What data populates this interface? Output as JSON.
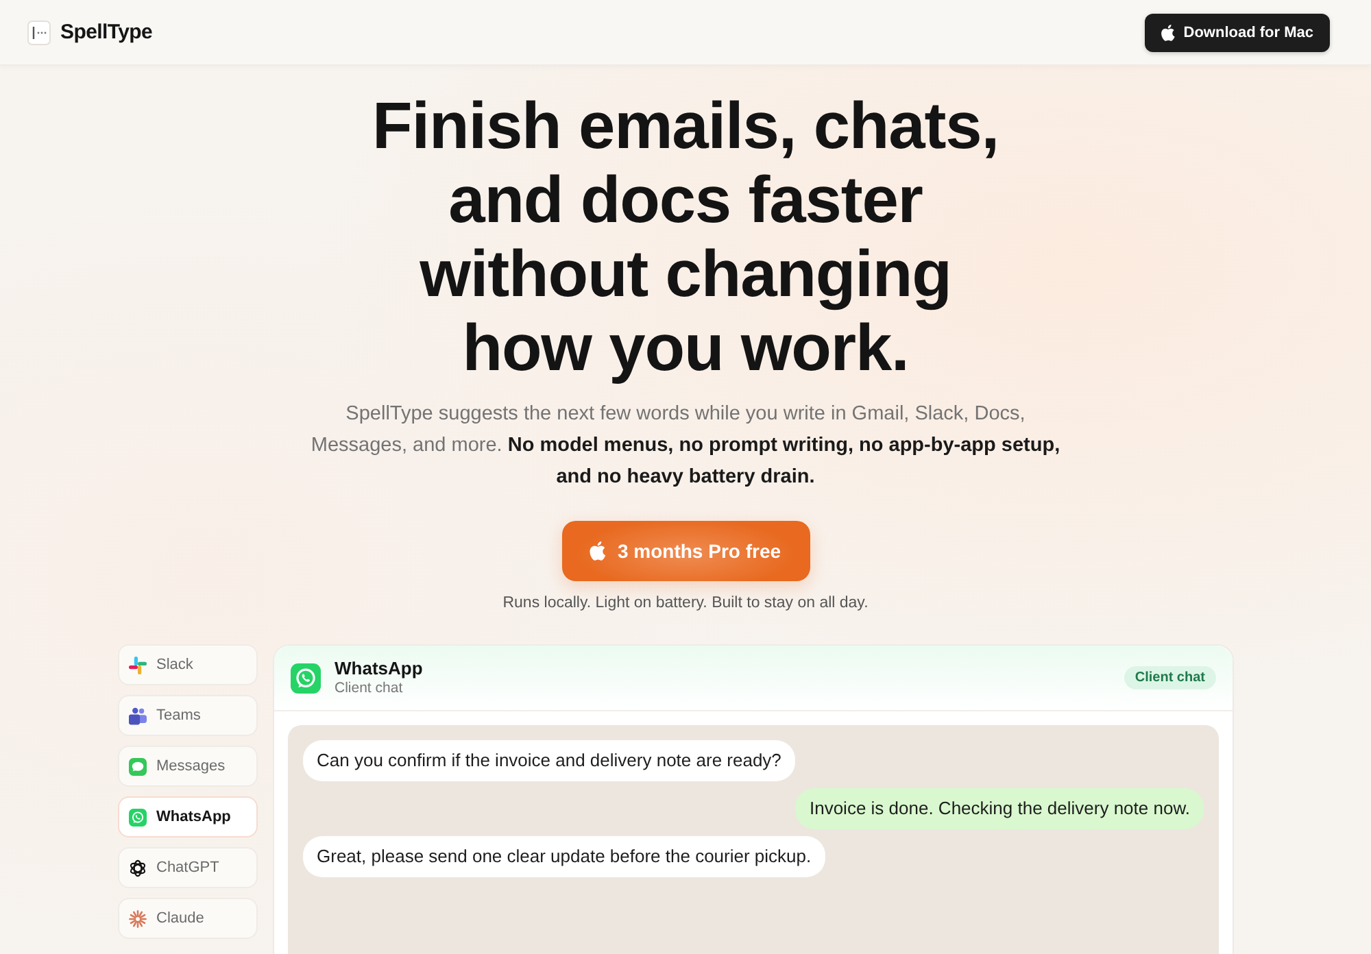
{
  "nav": {
    "brand": "SpellType",
    "download_button": "Download for Mac"
  },
  "hero": {
    "headline": "Finish emails, chats, and docs faster without changing how you work.",
    "subtitle": "SpellType suggests the next few words while you write in Gmail, Slack, Docs, Messages, and more. **No model menus, no prompt writing, no app-by-app setup, and no heavy battery drain.**",
    "cta_button": "3 months Pro free",
    "note": "Runs locally. Light on battery. Built to stay on all day."
  },
  "demo": {
    "apps": [
      {
        "label": "Slack",
        "selected": false
      },
      {
        "label": "Teams",
        "selected": false
      },
      {
        "label": "Messages",
        "selected": false
      },
      {
        "label": "WhatsApp",
        "selected": true
      },
      {
        "label": "ChatGPT",
        "selected": false
      },
      {
        "label": "Claude",
        "selected": false
      }
    ],
    "chat": {
      "title": "WhatsApp",
      "subtitle": "Client chat",
      "badge": "Client chat",
      "messages": [
        {
          "kind": "incoming",
          "text": "Can you confirm if the invoice and delivery note are ready?"
        },
        {
          "kind": "outgoing",
          "text": "Invoice is done. Checking the delivery note now."
        },
        {
          "kind": "incoming",
          "text": "Great, please send one clear update before the courier pickup."
        }
      ]
    }
  }
}
